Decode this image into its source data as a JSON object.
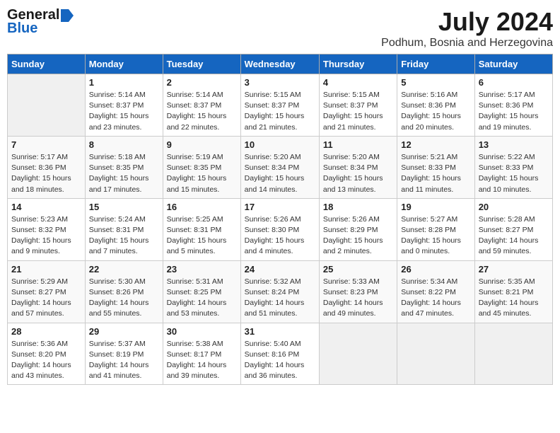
{
  "logo": {
    "general": "General",
    "blue": "Blue"
  },
  "title": {
    "month": "July 2024",
    "location": "Podhum, Bosnia and Herzegovina"
  },
  "weekdays": [
    "Sunday",
    "Monday",
    "Tuesday",
    "Wednesday",
    "Thursday",
    "Friday",
    "Saturday"
  ],
  "weeks": [
    [
      {
        "day": "",
        "info": ""
      },
      {
        "day": "1",
        "info": "Sunrise: 5:14 AM\nSunset: 8:37 PM\nDaylight: 15 hours\nand 23 minutes."
      },
      {
        "day": "2",
        "info": "Sunrise: 5:14 AM\nSunset: 8:37 PM\nDaylight: 15 hours\nand 22 minutes."
      },
      {
        "day": "3",
        "info": "Sunrise: 5:15 AM\nSunset: 8:37 PM\nDaylight: 15 hours\nand 21 minutes."
      },
      {
        "day": "4",
        "info": "Sunrise: 5:15 AM\nSunset: 8:37 PM\nDaylight: 15 hours\nand 21 minutes."
      },
      {
        "day": "5",
        "info": "Sunrise: 5:16 AM\nSunset: 8:36 PM\nDaylight: 15 hours\nand 20 minutes."
      },
      {
        "day": "6",
        "info": "Sunrise: 5:17 AM\nSunset: 8:36 PM\nDaylight: 15 hours\nand 19 minutes."
      }
    ],
    [
      {
        "day": "7",
        "info": "Sunrise: 5:17 AM\nSunset: 8:36 PM\nDaylight: 15 hours\nand 18 minutes."
      },
      {
        "day": "8",
        "info": "Sunrise: 5:18 AM\nSunset: 8:35 PM\nDaylight: 15 hours\nand 17 minutes."
      },
      {
        "day": "9",
        "info": "Sunrise: 5:19 AM\nSunset: 8:35 PM\nDaylight: 15 hours\nand 15 minutes."
      },
      {
        "day": "10",
        "info": "Sunrise: 5:20 AM\nSunset: 8:34 PM\nDaylight: 15 hours\nand 14 minutes."
      },
      {
        "day": "11",
        "info": "Sunrise: 5:20 AM\nSunset: 8:34 PM\nDaylight: 15 hours\nand 13 minutes."
      },
      {
        "day": "12",
        "info": "Sunrise: 5:21 AM\nSunset: 8:33 PM\nDaylight: 15 hours\nand 11 minutes."
      },
      {
        "day": "13",
        "info": "Sunrise: 5:22 AM\nSunset: 8:33 PM\nDaylight: 15 hours\nand 10 minutes."
      }
    ],
    [
      {
        "day": "14",
        "info": "Sunrise: 5:23 AM\nSunset: 8:32 PM\nDaylight: 15 hours\nand 9 minutes."
      },
      {
        "day": "15",
        "info": "Sunrise: 5:24 AM\nSunset: 8:31 PM\nDaylight: 15 hours\nand 7 minutes."
      },
      {
        "day": "16",
        "info": "Sunrise: 5:25 AM\nSunset: 8:31 PM\nDaylight: 15 hours\nand 5 minutes."
      },
      {
        "day": "17",
        "info": "Sunrise: 5:26 AM\nSunset: 8:30 PM\nDaylight: 15 hours\nand 4 minutes."
      },
      {
        "day": "18",
        "info": "Sunrise: 5:26 AM\nSunset: 8:29 PM\nDaylight: 15 hours\nand 2 minutes."
      },
      {
        "day": "19",
        "info": "Sunrise: 5:27 AM\nSunset: 8:28 PM\nDaylight: 15 hours\nand 0 minutes."
      },
      {
        "day": "20",
        "info": "Sunrise: 5:28 AM\nSunset: 8:27 PM\nDaylight: 14 hours\nand 59 minutes."
      }
    ],
    [
      {
        "day": "21",
        "info": "Sunrise: 5:29 AM\nSunset: 8:27 PM\nDaylight: 14 hours\nand 57 minutes."
      },
      {
        "day": "22",
        "info": "Sunrise: 5:30 AM\nSunset: 8:26 PM\nDaylight: 14 hours\nand 55 minutes."
      },
      {
        "day": "23",
        "info": "Sunrise: 5:31 AM\nSunset: 8:25 PM\nDaylight: 14 hours\nand 53 minutes."
      },
      {
        "day": "24",
        "info": "Sunrise: 5:32 AM\nSunset: 8:24 PM\nDaylight: 14 hours\nand 51 minutes."
      },
      {
        "day": "25",
        "info": "Sunrise: 5:33 AM\nSunset: 8:23 PM\nDaylight: 14 hours\nand 49 minutes."
      },
      {
        "day": "26",
        "info": "Sunrise: 5:34 AM\nSunset: 8:22 PM\nDaylight: 14 hours\nand 47 minutes."
      },
      {
        "day": "27",
        "info": "Sunrise: 5:35 AM\nSunset: 8:21 PM\nDaylight: 14 hours\nand 45 minutes."
      }
    ],
    [
      {
        "day": "28",
        "info": "Sunrise: 5:36 AM\nSunset: 8:20 PM\nDaylight: 14 hours\nand 43 minutes."
      },
      {
        "day": "29",
        "info": "Sunrise: 5:37 AM\nSunset: 8:19 PM\nDaylight: 14 hours\nand 41 minutes."
      },
      {
        "day": "30",
        "info": "Sunrise: 5:38 AM\nSunset: 8:17 PM\nDaylight: 14 hours\nand 39 minutes."
      },
      {
        "day": "31",
        "info": "Sunrise: 5:40 AM\nSunset: 8:16 PM\nDaylight: 14 hours\nand 36 minutes."
      },
      {
        "day": "",
        "info": ""
      },
      {
        "day": "",
        "info": ""
      },
      {
        "day": "",
        "info": ""
      }
    ]
  ]
}
